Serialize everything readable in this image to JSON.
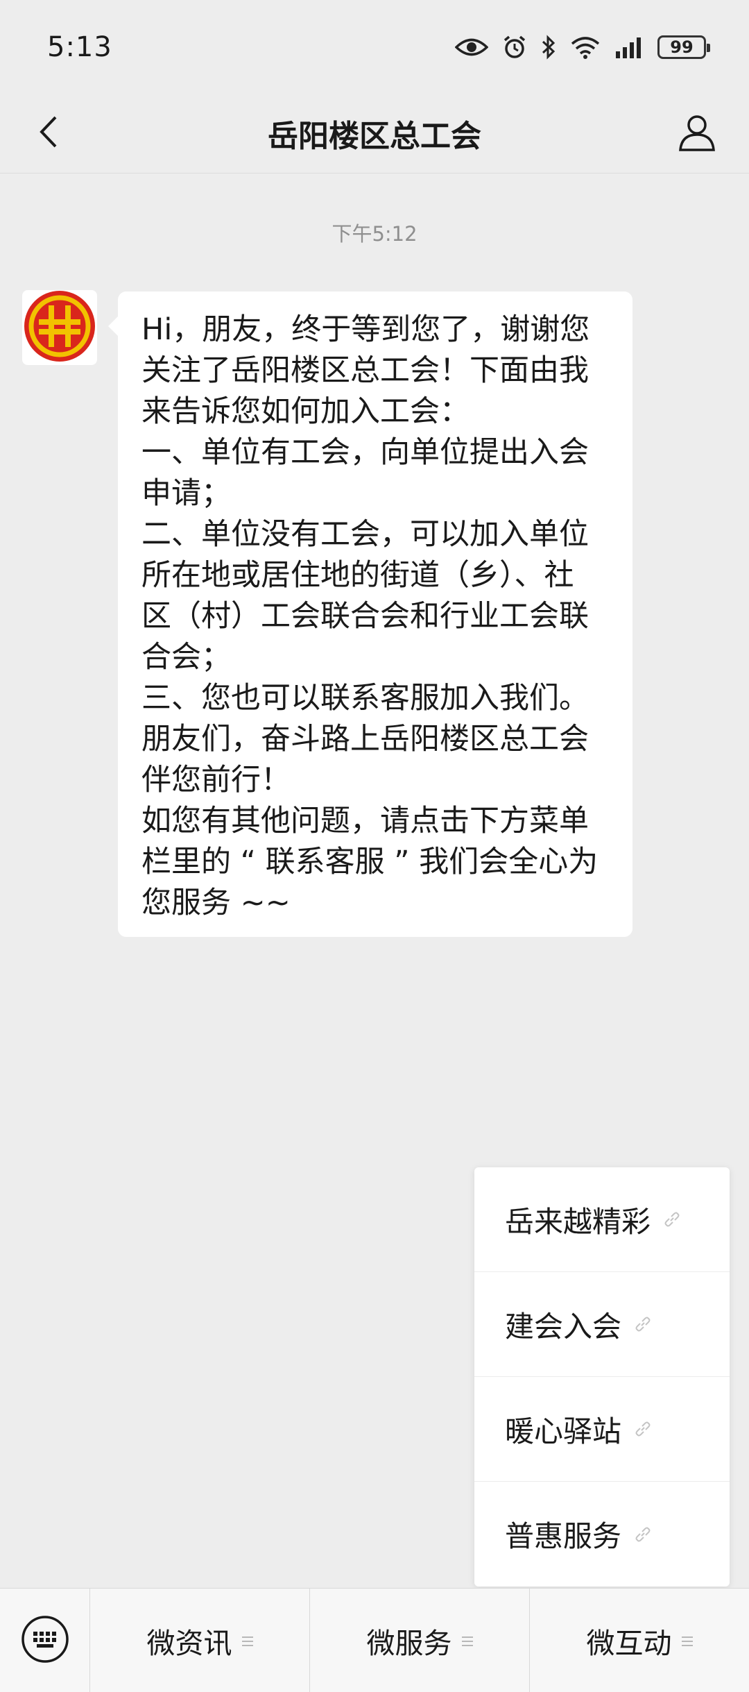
{
  "status_bar": {
    "time": "5:13",
    "battery": "99",
    "icons": [
      "eye-icon",
      "alarm-icon",
      "bluetooth-icon",
      "wifi-icon",
      "signal-icon",
      "battery-icon"
    ]
  },
  "nav": {
    "title": "岳阳楼区总工会",
    "icons": [
      "back-chevron-icon",
      "profile-icon"
    ]
  },
  "chat": {
    "timestamp": "下午5:12",
    "message_lines": [
      "Hi，朋友，终于等到您了，谢谢您",
      "关注了岳阳楼区总工会！下面由我",
      "来告诉您如何加入工会：",
      "一、单位有工会，向单位提出入会",
      "申请；",
      "二、单位没有工会，可以加入单位",
      "所在地或居住地的街道（乡）、社",
      "区（村）工会联合会和行业工会联",
      "合会；",
      "三、您也可以联系客服加入我们。",
      "朋友们，奋斗路上岳阳楼区总工会",
      "伴您前行！",
      "如您有其他问题，请点击下方菜单",
      "栏里的 “ 联系客服 ” 我们会全心为",
      "您服务 ~~"
    ]
  },
  "popup_menu": {
    "items": [
      {
        "label": "岳来越精彩",
        "icon": "link-icon"
      },
      {
        "label": "建会入会",
        "icon": "link-icon"
      },
      {
        "label": "暖心驿站",
        "icon": "link-icon"
      },
      {
        "label": "普惠服务",
        "icon": "link-icon"
      }
    ]
  },
  "bottom_menu": {
    "keyboard_icon": "keyboard-icon",
    "tabs": [
      {
        "label": "微资讯"
      },
      {
        "label": "微服务"
      },
      {
        "label": "微互动"
      }
    ]
  },
  "colors": {
    "background": "#ededed",
    "bubble": "#ffffff",
    "logo_red": "#d9261c",
    "logo_gold": "#f2c200"
  }
}
